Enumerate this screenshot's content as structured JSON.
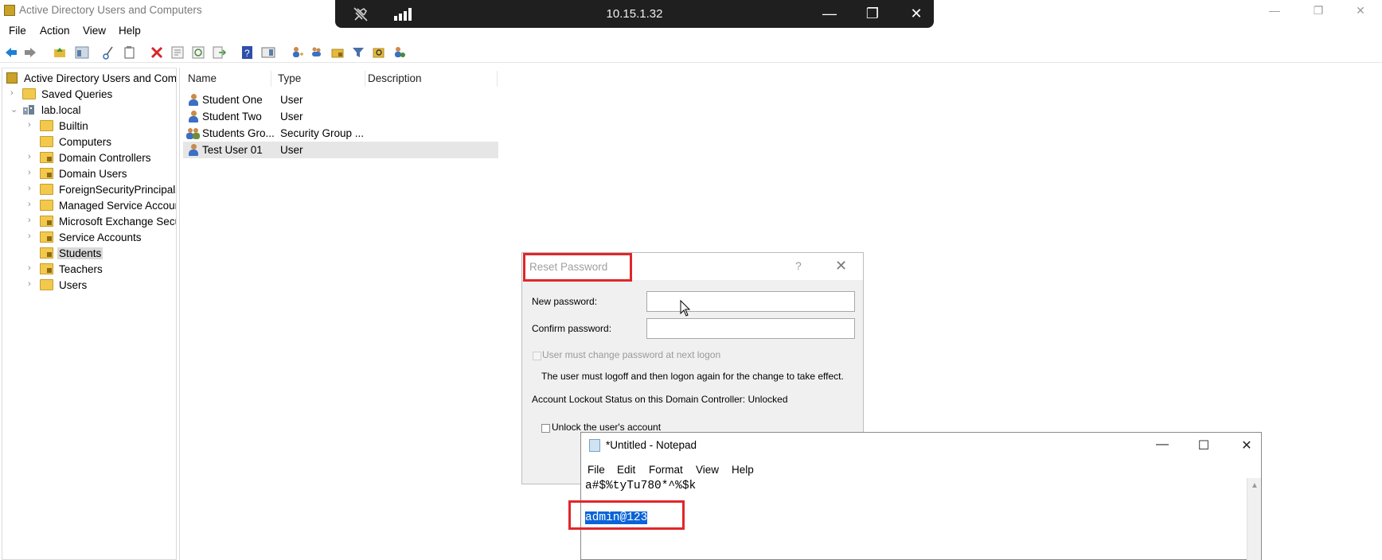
{
  "window": {
    "title": "Active Directory Users and Computers",
    "controls": {
      "minimize": "—",
      "restore": "❐",
      "close": "✕"
    }
  },
  "rdp_bar": {
    "host": "10.15.1.32",
    "controls": {
      "minimize": "—",
      "restore": "❐",
      "close": "✕"
    }
  },
  "menu": [
    "File",
    "Action",
    "View",
    "Help"
  ],
  "toolbar": {
    "icons": [
      "back-arrow-icon",
      "forward-arrow-icon",
      "up-folder-icon",
      "show-hide-tree-icon",
      "cut-icon",
      "copy-icon",
      "delete-icon",
      "properties-icon",
      "refresh-icon",
      "export-list-icon",
      "help-icon",
      "show-pane-icon",
      "new-user-icon",
      "new-group-icon",
      "new-ou-icon",
      "filter-icon",
      "find-icon",
      "add-to-group-icon"
    ]
  },
  "tree": {
    "root": "Active Directory Users and Comp",
    "items": [
      {
        "label": "Saved Queries",
        "expander": "›",
        "kind": "folder"
      },
      {
        "label": "lab.local",
        "expander": "⌄",
        "kind": "domain"
      },
      {
        "label": "Builtin",
        "expander": "›",
        "kind": "folder"
      },
      {
        "label": "Computers",
        "expander": "",
        "kind": "folder"
      },
      {
        "label": "Domain Controllers",
        "expander": "›",
        "kind": "ou"
      },
      {
        "label": "Domain Users",
        "expander": "›",
        "kind": "ou"
      },
      {
        "label": "ForeignSecurityPrincipals",
        "expander": "›",
        "kind": "folder"
      },
      {
        "label": "Managed Service Accoun",
        "expander": "›",
        "kind": "folder"
      },
      {
        "label": "Microsoft Exchange Secu",
        "expander": "›",
        "kind": "ou"
      },
      {
        "label": "Service Accounts",
        "expander": "›",
        "kind": "ou"
      },
      {
        "label": "Students",
        "expander": "",
        "kind": "ou",
        "selected": true
      },
      {
        "label": "Teachers",
        "expander": "›",
        "kind": "ou"
      },
      {
        "label": "Users",
        "expander": "›",
        "kind": "folder"
      }
    ]
  },
  "list": {
    "columns": [
      "Name",
      "Type",
      "Description"
    ],
    "rows": [
      {
        "name": "Student One",
        "type": "User",
        "icon": "user-icon"
      },
      {
        "name": "Student Two",
        "type": "User",
        "icon": "user-icon"
      },
      {
        "name": "Students Gro...",
        "type": "Security Group ...",
        "icon": "group-icon"
      },
      {
        "name": "Test User 01",
        "type": "User",
        "icon": "user-icon",
        "selected": true
      }
    ]
  },
  "reset_dialog": {
    "title": "Reset Password",
    "help": "?",
    "close": "✕",
    "new_password_label": "New password:",
    "confirm_password_label": "Confirm password:",
    "new_password_value": "",
    "confirm_password_value": "",
    "must_change_label": "User must change password at next logon",
    "logoff_note": "The user must logoff and then logon again for the change to take effect.",
    "lockout_status": "Account Lockout Status on this Domain Controller: Unlocked",
    "unlock_label": "Unlock the user's account",
    "highlight_color": "#e0272b"
  },
  "notepad": {
    "title": "*Untitled - Notepad",
    "menu": [
      "File",
      "Edit",
      "Format",
      "View",
      "Help"
    ],
    "lines": [
      "a#$%tyTu780*^%$k",
      "",
      "admin@123"
    ],
    "selected_text": "admin@123",
    "controls": {
      "minimize": "—",
      "maximize": "☐",
      "close": "✕"
    },
    "selection_color": "#0a64d8"
  }
}
